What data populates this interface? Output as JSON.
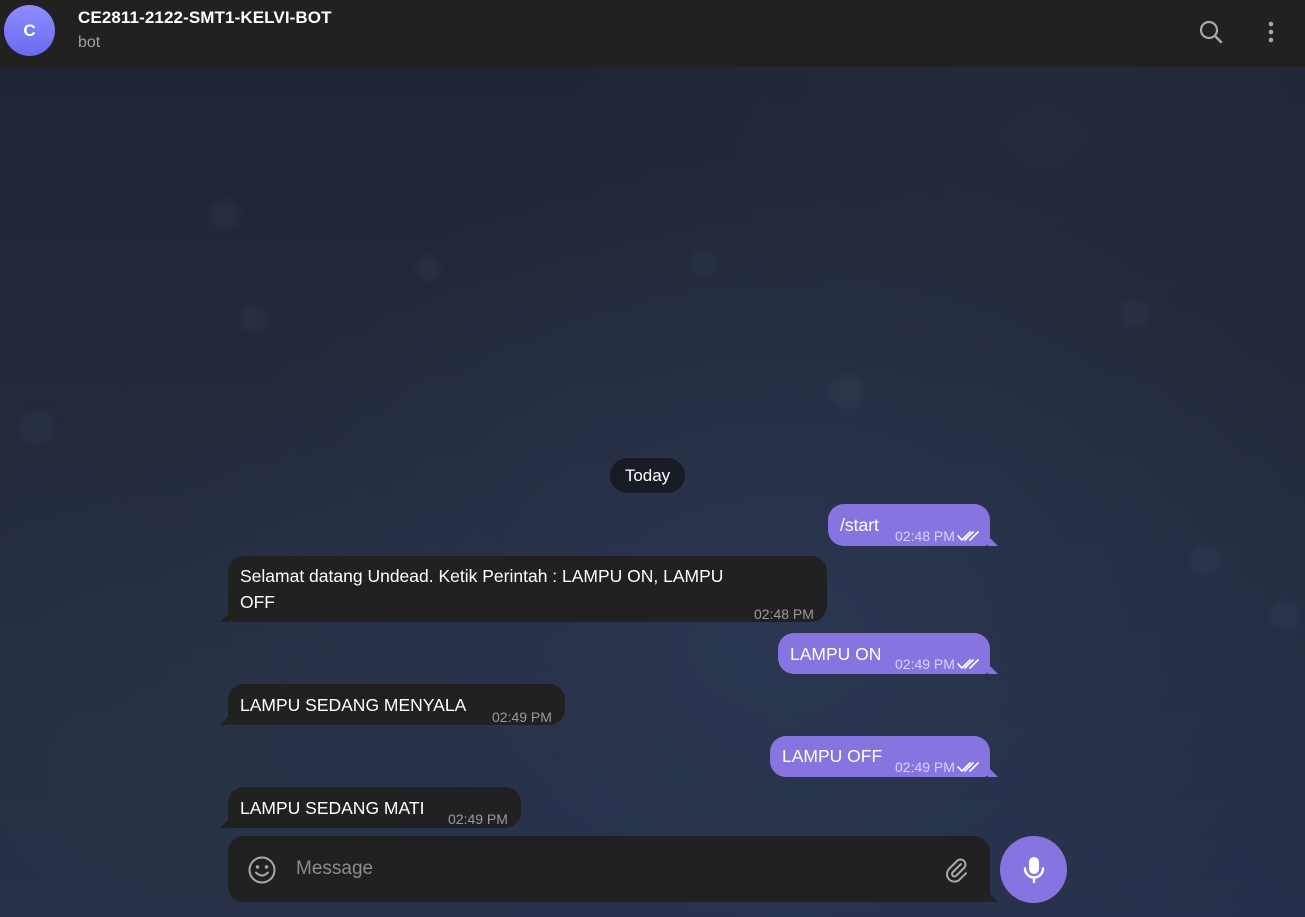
{
  "header": {
    "avatar_letter": "C",
    "title": "CE2811-2122-SMT1-KELVI-BOT",
    "subtitle": "bot",
    "search_icon": "search-icon",
    "menu_icon": "more-vertical-icon"
  },
  "date_separator": "Today",
  "messages": [
    {
      "direction": "out",
      "text": "/start",
      "time": "02:48 PM",
      "status": "read"
    },
    {
      "direction": "in",
      "text_line1": "Selamat datang Undead. Ketik Perintah : LAMPU ON, LAMPU",
      "text_line2": "OFF",
      "time": "02:48 PM"
    },
    {
      "direction": "out",
      "text": "LAMPU ON",
      "time": "02:49 PM",
      "status": "read"
    },
    {
      "direction": "in",
      "text": "LAMPU SEDANG MENYALA",
      "time": "02:49 PM"
    },
    {
      "direction": "out",
      "text": "LAMPU OFF",
      "time": "02:49 PM",
      "status": "read"
    },
    {
      "direction": "in",
      "text": "LAMPU SEDANG MATI",
      "time": "02:49 PM"
    }
  ],
  "composer": {
    "placeholder": "Message",
    "emoji_icon": "smile-icon",
    "attach_icon": "paperclip-icon",
    "send_icon": "microphone-icon"
  },
  "colors": {
    "accent": "#8774e1",
    "header_bg": "#212121",
    "incoming_bubble": "#212121"
  }
}
